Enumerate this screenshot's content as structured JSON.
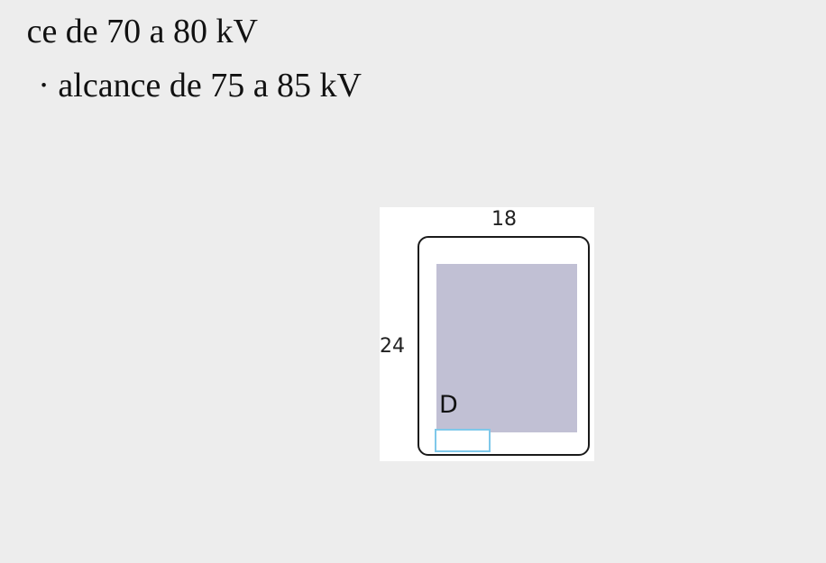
{
  "text": {
    "line_1": "ce de 70 a 80 kV",
    "line_2": "· alcance de 75 a 85 kV"
  },
  "diagram": {
    "width_label": "18",
    "height_label": "24",
    "letter": "D",
    "colors": {
      "sensitive_area": "#c1c0d4",
      "id_tab": "#7fc8ea",
      "frame_border": "#1a1a1a"
    }
  }
}
